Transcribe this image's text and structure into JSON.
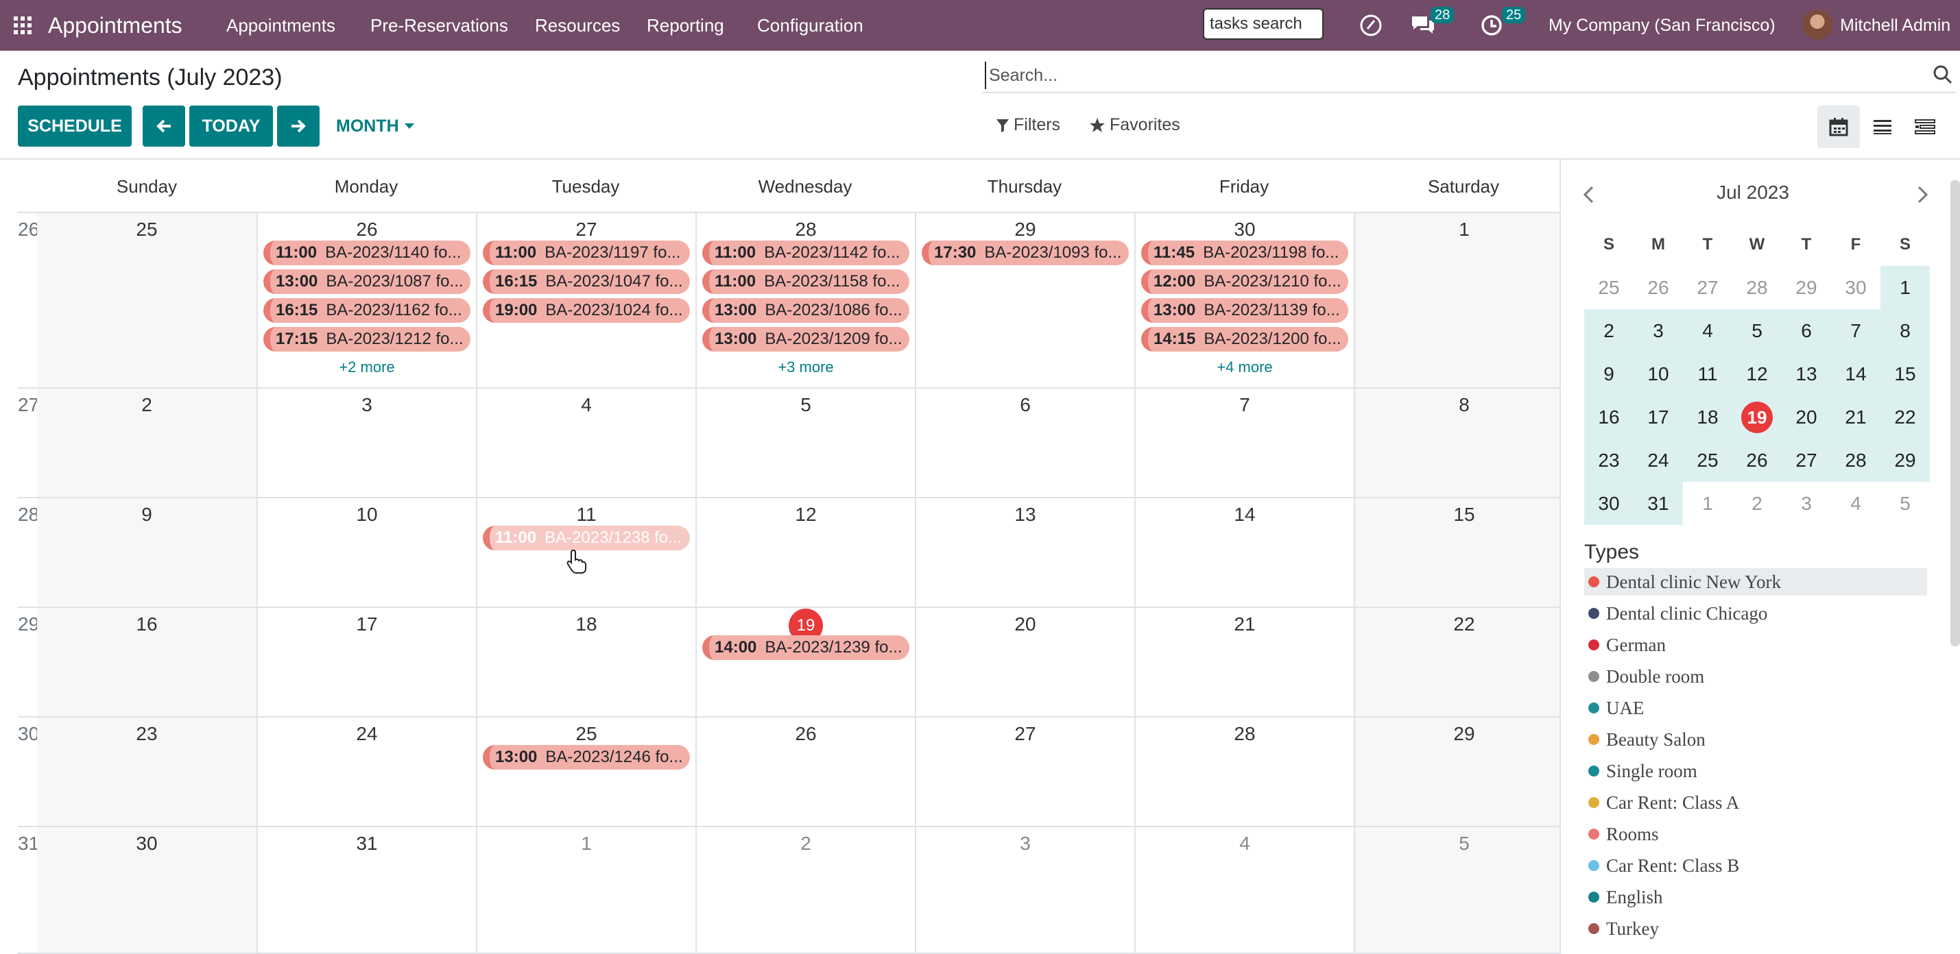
{
  "navbar": {
    "brand": "Appointments",
    "menu": [
      "Appointments",
      "Pre-Reservations",
      "Resources",
      "Reporting",
      "Configuration"
    ],
    "tasks_search_placeholder": "tasks search",
    "messages_count": "28",
    "activities_count": "25",
    "company": "My Company (San Francisco)",
    "user": "Mitchell Admin",
    "bg_color": "#714B67"
  },
  "control": {
    "title": "Appointments (July 2023)",
    "schedule_label": "SCHEDULE",
    "today_label": "TODAY",
    "scale_label": "MONTH",
    "search_placeholder": "Search...",
    "filters_label": "Filters",
    "favorites_label": "Favorites",
    "accent": "#017E84"
  },
  "calendar": {
    "weekdays": [
      "Sunday",
      "Monday",
      "Tuesday",
      "Wednesday",
      "Thursday",
      "Friday",
      "Saturday"
    ],
    "weeks": [
      {
        "num": "26",
        "days": [
          "25",
          "26",
          "27",
          "28",
          "29",
          "30",
          "1"
        ],
        "events": [
          [],
          [
            {
              "t": "11:00",
              "n": "BA-2023/1140 fo..."
            },
            {
              "t": "13:00",
              "n": "BA-2023/1087 fo..."
            },
            {
              "t": "16:15",
              "n": "BA-2023/1162 fo..."
            },
            {
              "t": "17:15",
              "n": "BA-2023/1212 fo..."
            }
          ],
          [
            {
              "t": "11:00",
              "n": "BA-2023/1197 fo..."
            },
            {
              "t": "16:15",
              "n": "BA-2023/1047 fo..."
            },
            {
              "t": "19:00",
              "n": "BA-2023/1024 fo..."
            }
          ],
          [
            {
              "t": "11:00",
              "n": "BA-2023/1142 fo..."
            },
            {
              "t": "11:00",
              "n": "BA-2023/1158 fo..."
            },
            {
              "t": "13:00",
              "n": "BA-2023/1086 fo..."
            },
            {
              "t": "13:00",
              "n": "BA-2023/1209 fo..."
            }
          ],
          [
            {
              "t": "17:30",
              "n": "BA-2023/1093 fo..."
            }
          ],
          [
            {
              "t": "11:45",
              "n": "BA-2023/1198 fo..."
            },
            {
              "t": "12:00",
              "n": "BA-2023/1210 fo..."
            },
            {
              "t": "13:00",
              "n": "BA-2023/1139 fo..."
            },
            {
              "t": "14:15",
              "n": "BA-2023/1200 fo..."
            }
          ],
          []
        ],
        "more": [
          "",
          "+2 more",
          "",
          "+3 more",
          "",
          "+4 more",
          ""
        ]
      },
      {
        "num": "27",
        "days": [
          "2",
          "3",
          "4",
          "5",
          "6",
          "7",
          "8"
        ],
        "events": [
          [],
          [],
          [],
          [],
          [],
          [],
          []
        ],
        "more": [
          "",
          "",
          "",
          "",
          "",
          "",
          ""
        ]
      },
      {
        "num": "28",
        "days": [
          "9",
          "10",
          "11",
          "12",
          "13",
          "14",
          "15"
        ],
        "events": [
          [],
          [],
          [
            {
              "t": "11:00",
              "n": "BA-2023/1238 fo...",
              "light": true
            }
          ],
          [],
          [],
          [],
          []
        ],
        "more": [
          "",
          "",
          "",
          "",
          "",
          "",
          ""
        ]
      },
      {
        "num": "29",
        "days": [
          "16",
          "17",
          "18",
          "19",
          "20",
          "21",
          "22"
        ],
        "events": [
          [],
          [],
          [],
          [
            {
              "t": "14:00",
              "n": "BA-2023/1239 fo..."
            }
          ],
          [],
          [],
          []
        ],
        "more": [
          "",
          "",
          "",
          "",
          "",
          "",
          ""
        ]
      },
      {
        "num": "30",
        "days": [
          "23",
          "24",
          "25",
          "26",
          "27",
          "28",
          "29"
        ],
        "events": [
          [],
          [],
          [
            {
              "t": "13:00",
              "n": "BA-2023/1246 fo..."
            }
          ],
          [],
          [],
          [],
          []
        ],
        "more": [
          "",
          "",
          "",
          "",
          "",
          "",
          ""
        ]
      },
      {
        "num": "31",
        "days": [
          "30",
          "31",
          "1",
          "2",
          "3",
          "4",
          "5"
        ],
        "events": [
          [],
          [],
          [],
          [],
          [],
          [],
          []
        ],
        "more": [
          "",
          "",
          "",
          "",
          "",
          "",
          ""
        ]
      }
    ],
    "today": "19",
    "event_color": "#F2AFA8",
    "today_color": "#E8393B"
  },
  "sidebar": {
    "mini_title": "Jul 2023",
    "day_heads": [
      "S",
      "M",
      "T",
      "W",
      "T",
      "F",
      "S"
    ],
    "mini_weeks": [
      [
        "25",
        "26",
        "27",
        "28",
        "29",
        "30",
        "1"
      ],
      [
        "2",
        "3",
        "4",
        "5",
        "6",
        "7",
        "8"
      ],
      [
        "9",
        "10",
        "11",
        "12",
        "13",
        "14",
        "15"
      ],
      [
        "16",
        "17",
        "18",
        "19",
        "20",
        "21",
        "22"
      ],
      [
        "23",
        "24",
        "25",
        "26",
        "27",
        "28",
        "29"
      ],
      [
        "30",
        "31",
        "1",
        "2",
        "3",
        "4",
        "5"
      ]
    ],
    "types_title": "Types",
    "types": [
      {
        "label": "Dental clinic New York",
        "color": "#E8574A"
      },
      {
        "label": "Dental clinic Chicago",
        "color": "#3F4A6B"
      },
      {
        "label": "German",
        "color": "#D92D3C"
      },
      {
        "label": "Double room",
        "color": "#8E8E8E"
      },
      {
        "label": "UAE",
        "color": "#1F8E96"
      },
      {
        "label": "Beauty Salon",
        "color": "#E8A13B"
      },
      {
        "label": "Single room",
        "color": "#1A8C94"
      },
      {
        "label": "Car Rent: Class A",
        "color": "#E0AE3A"
      },
      {
        "label": "Rooms",
        "color": "#E87774"
      },
      {
        "label": "Car Rent: Class B",
        "color": "#6CC0E8"
      },
      {
        "label": "English",
        "color": "#17808A"
      },
      {
        "label": "Turkey",
        "color": "#A55453"
      }
    ]
  }
}
